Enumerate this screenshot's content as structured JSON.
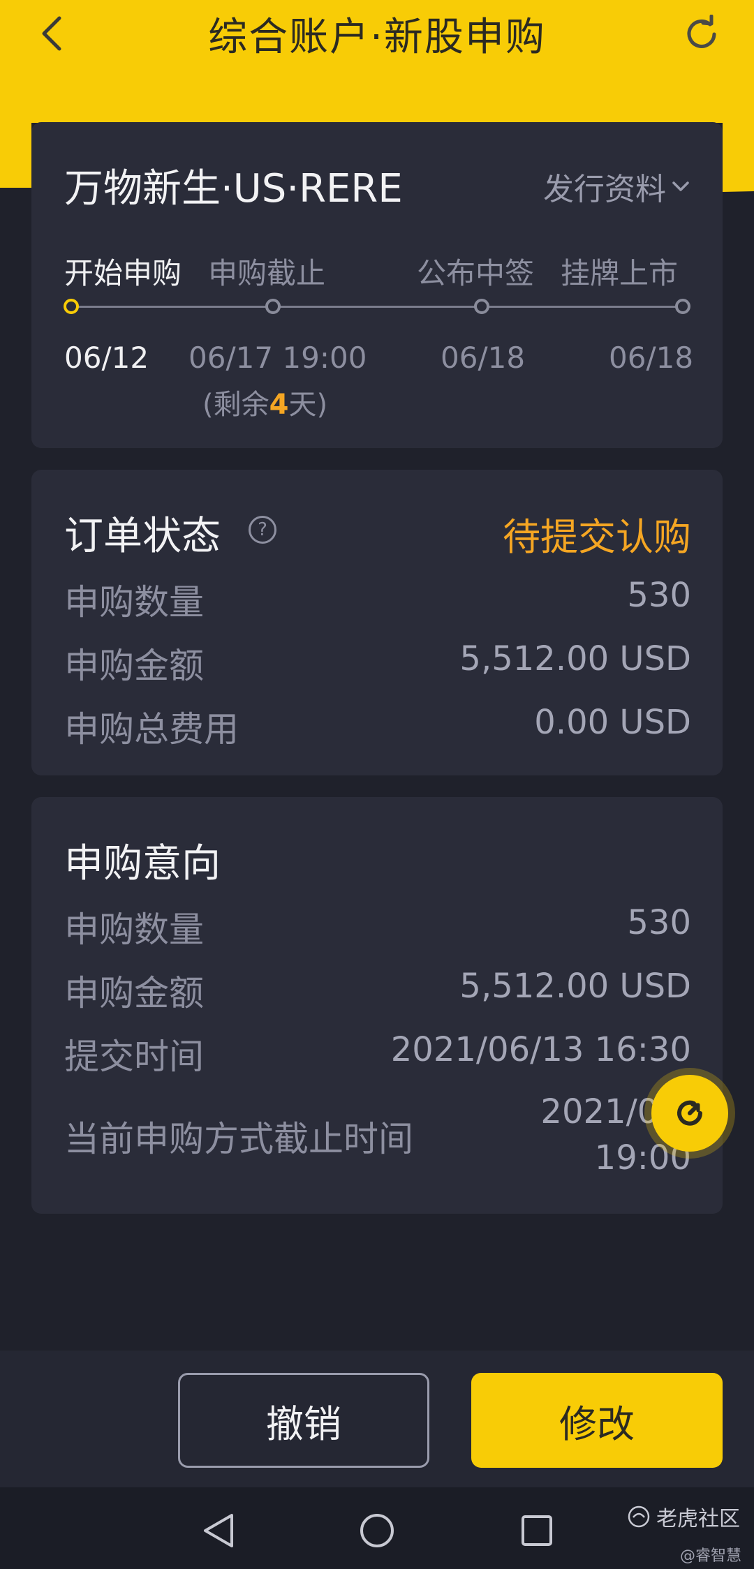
{
  "header": {
    "title": "综合账户·新股申购"
  },
  "ipo": {
    "stock_name": "万物新生·US·RERE",
    "issue_info_label": "发行资料",
    "steps": [
      {
        "label": "开始申购",
        "date": "06/12"
      },
      {
        "label": "申购截止",
        "date": "06/17 19:00"
      },
      {
        "label": "公布中签",
        "date": "06/18"
      },
      {
        "label": "挂牌上市",
        "date": "06/18"
      }
    ],
    "remaining_prefix": "(剩余",
    "remaining_days": "4",
    "remaining_suffix": "天)"
  },
  "order_status": {
    "title": "订单状态",
    "status": "待提交认购",
    "rows": [
      {
        "label": "申购数量",
        "value": "530"
      },
      {
        "label": "申购金额",
        "value": "5,512.00 USD"
      },
      {
        "label": "申购总费用",
        "value": "0.00 USD"
      }
    ]
  },
  "intent": {
    "title": "申购意向",
    "rows": [
      {
        "label": "申购数量",
        "value": "530"
      },
      {
        "label": "申购金额",
        "value": "5,512.00 USD"
      },
      {
        "label": "提交时间",
        "value": "2021/06/13 16:30"
      }
    ],
    "deadline_label": "当前申购方式截止时间",
    "deadline_line1": "2021/06/",
    "deadline_line2": "19:00"
  },
  "actions": {
    "cancel_label": "撤销",
    "modify_label": "修改"
  },
  "watermark": {
    "brand": "老虎社区",
    "author": "@睿智慧"
  },
  "colors": {
    "accent": "#f8cc06",
    "status": "#f5a623",
    "card_bg": "#2a2c39",
    "page_bg": "#1f212b"
  }
}
